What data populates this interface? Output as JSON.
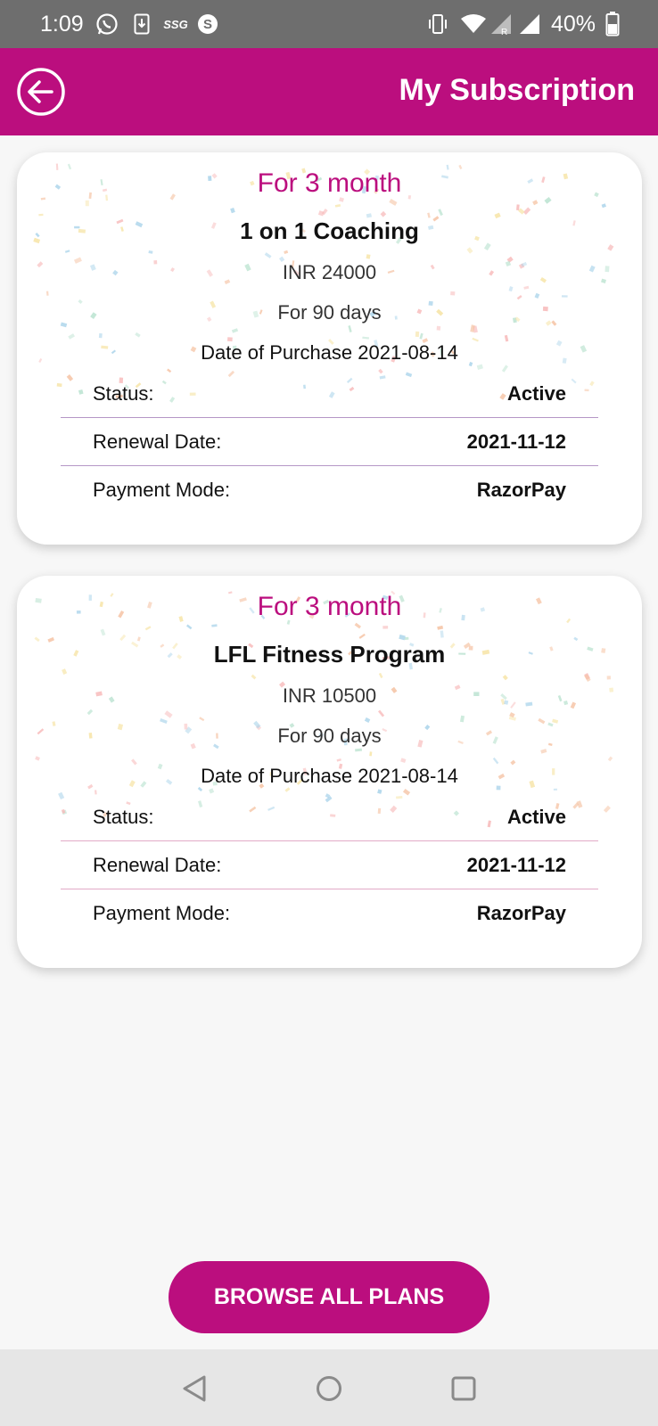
{
  "status_bar": {
    "time": "1:09",
    "ssg": "SSG",
    "battery": "40%",
    "icons": [
      "whatsapp-icon",
      "download-icon",
      "ssg-icon",
      "skype-icon",
      "vibrate-icon",
      "wifi-icon",
      "signal-icon",
      "signal-icon",
      "battery-icon"
    ]
  },
  "header": {
    "title": "My Subscription",
    "back_icon": "back-arrow-circle-icon",
    "background": "#bb0e7e"
  },
  "subscriptions": [
    {
      "period": "For 3 month",
      "plan": "1 on 1 Coaching",
      "price": "INR 24000",
      "duration": "For 90 days",
      "purchase": "Date of Purchase 2021-08-14",
      "rows": [
        {
          "label": "Status:",
          "value": "Active"
        },
        {
          "label": "Renewal Date:",
          "value": "2021-11-12"
        },
        {
          "label": "Payment Mode:",
          "value": "RazorPay"
        }
      ]
    },
    {
      "period": "For 3 month",
      "plan": "LFL Fitness Program",
      "price": "INR 10500",
      "duration": "For 90 days",
      "purchase": "Date of Purchase 2021-08-14",
      "rows": [
        {
          "label": "Status:",
          "value": "Active"
        },
        {
          "label": "Renewal Date:",
          "value": "2021-11-12"
        },
        {
          "label": "Payment Mode:",
          "value": "RazorPay"
        }
      ]
    }
  ],
  "browse_button": "BROWSE ALL PLANS",
  "nav_bar": {
    "icons": [
      "back-triangle-icon",
      "home-circle-icon",
      "recents-square-icon"
    ]
  },
  "colors": {
    "accent": "#bb0e7e",
    "status_bar": "#6e6e6e",
    "background": "#f7f7f7"
  }
}
